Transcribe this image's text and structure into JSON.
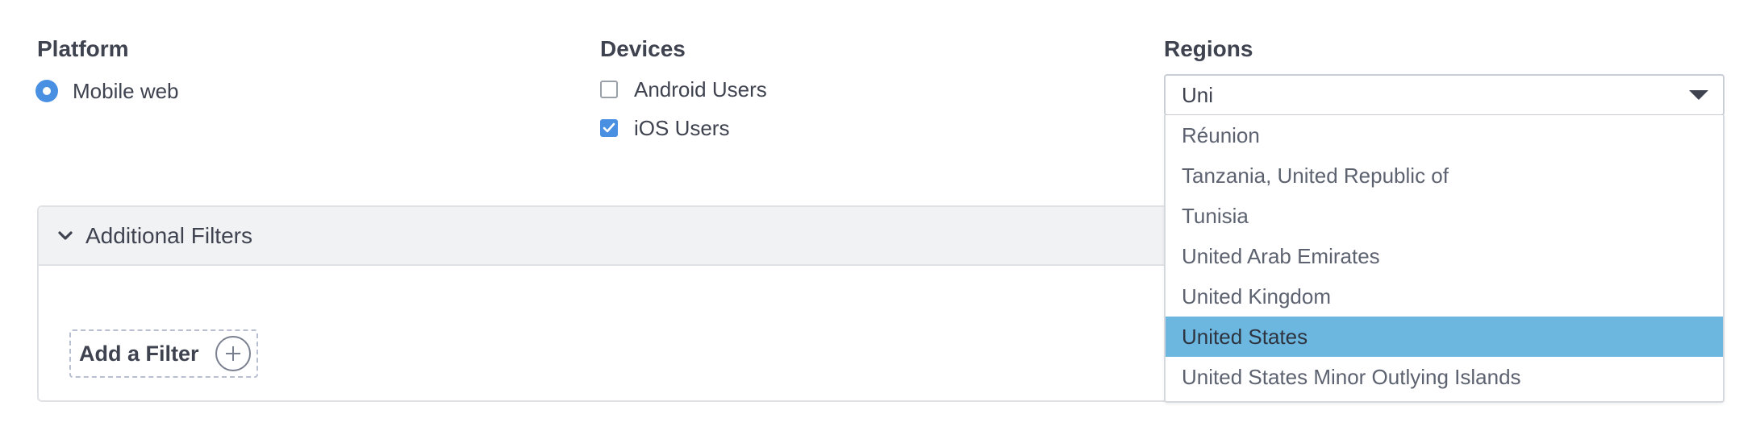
{
  "platform": {
    "heading": "Platform",
    "options": [
      {
        "label": "Mobile web",
        "selected": true
      }
    ]
  },
  "devices": {
    "heading": "Devices",
    "options": [
      {
        "label": "Android Users",
        "checked": false
      },
      {
        "label": "iOS Users",
        "checked": true
      }
    ]
  },
  "regions": {
    "heading": "Regions",
    "input_value": "Uni",
    "options": [
      "Réunion",
      "Tanzania, United Republic of",
      "Tunisia",
      "United Arab Emirates",
      "United Kingdom",
      "United States",
      "United States Minor Outlying Islands"
    ],
    "highlighted": "United States"
  },
  "filters": {
    "title": "Additional Filters",
    "add_label": "Add a Filter"
  },
  "colors": {
    "accent": "#4a90e2",
    "highlight": "#6cb7df",
    "text": "#3f4350"
  },
  "icons": {
    "radio": "radio-selected-icon",
    "checkbox_checked": "check-icon",
    "collapse": "chevron-down-icon",
    "add": "plus-circle-icon",
    "select_caret": "caret-down-icon"
  }
}
